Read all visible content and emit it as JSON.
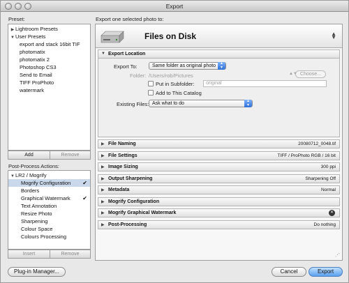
{
  "window": {
    "title": "Export"
  },
  "left": {
    "preset_label": "Preset:",
    "presets": [
      {
        "label": "Lightroom Presets",
        "level": 0,
        "expanded": false
      },
      {
        "label": "User Presets",
        "level": 0,
        "expanded": true
      },
      {
        "label": "export and stack 16bit TIF",
        "level": 1
      },
      {
        "label": "photomatix",
        "level": 1
      },
      {
        "label": "photomatix 2",
        "level": 1
      },
      {
        "label": "Photoshop CS3",
        "level": 1
      },
      {
        "label": "Send to Email",
        "level": 1
      },
      {
        "label": "TIFF ProPhoto",
        "level": 1
      },
      {
        "label": "watermark",
        "level": 1
      }
    ],
    "add_label": "Add",
    "remove_label": "Remove",
    "post_label": "Post-Process Actions:",
    "post_root": "LR2 / Mogrify",
    "post_actions": [
      {
        "label": "Mogrify Configuration",
        "checked": true
      },
      {
        "label": "Borders",
        "checked": false
      },
      {
        "label": "Graphical Watermark",
        "checked": true
      },
      {
        "label": "Text Annotation",
        "checked": false
      },
      {
        "label": "Resize Photo",
        "checked": false
      },
      {
        "label": "Sharpening",
        "checked": false
      },
      {
        "label": "Colour Space",
        "checked": false
      },
      {
        "label": "Colours Processing",
        "checked": false
      }
    ],
    "insert_label": "Insert",
    "remove2_label": "Remove",
    "check_glyph": "✔"
  },
  "right": {
    "header": "Export one selected photo to:",
    "destination": "Files on Disk",
    "export_location": {
      "title": "Export Location",
      "export_to_label": "Export To:",
      "export_to_value": "Same folder as original photo",
      "folder_label": "Folder:",
      "folder_value": "/Users/rob/Pictures",
      "choose_label": "Choose...",
      "subfolder_label": "Put in Subfolder:",
      "subfolder_placeholder": "original",
      "add_catalog_label": "Add to This Catalog",
      "existing_label": "Existing Files:",
      "existing_value": "Ask what to do"
    },
    "sections": [
      {
        "title": "File Naming",
        "value": "20080712_0048.tif"
      },
      {
        "title": "File Settings",
        "value": "TIFF / ProPhoto RGB / 16 bit"
      },
      {
        "title": "Image Sizing",
        "value": "300 ppi"
      },
      {
        "title": "Output Sharpening",
        "value": "Sharpening Off"
      },
      {
        "title": "Metadata",
        "value": "Normal"
      },
      {
        "title": "Mogrify Configuration",
        "value": ""
      },
      {
        "title": "Mogrify Graphical Watermark",
        "value": ""
      },
      {
        "title": "Post-Processing",
        "value": "Do nothing"
      }
    ]
  },
  "footer": {
    "plugin_manager": "Plug-in Manager...",
    "cancel": "Cancel",
    "export": "Export"
  }
}
